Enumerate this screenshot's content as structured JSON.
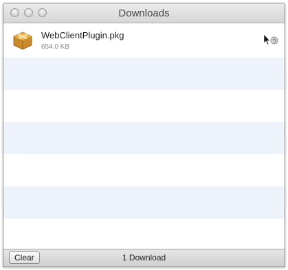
{
  "window": {
    "title": "Downloads"
  },
  "downloads": [
    {
      "filename": "WebClientPlugin.pkg",
      "size": "654.0 KB",
      "icon": "package-icon"
    }
  ],
  "footer": {
    "clear_label": "Clear",
    "status": "1 Download"
  },
  "colors": {
    "alt_row": "#eef2fb",
    "titlebar_top": "#ececec",
    "titlebar_bottom": "#d6d6d6"
  }
}
